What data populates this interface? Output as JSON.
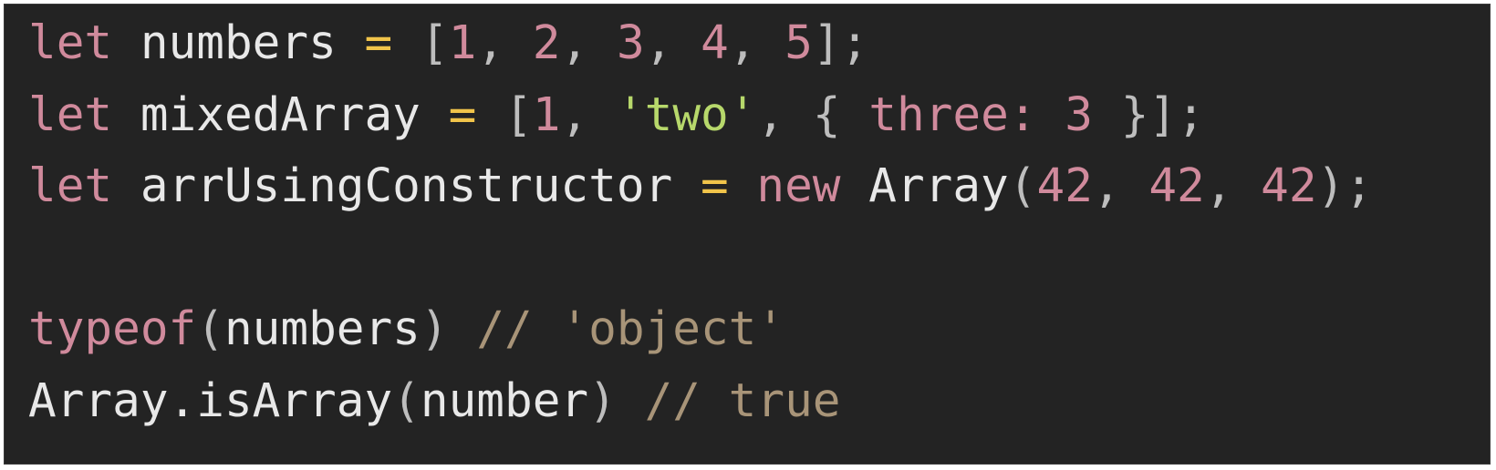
{
  "code": {
    "line1": {
      "kw": "let",
      "name": "numbers",
      "op": "=",
      "open": "[",
      "n1": "1",
      "n2": "2",
      "n3": "3",
      "n4": "4",
      "n5": "5",
      "close": "];"
    },
    "line2": {
      "kw": "let",
      "name": "mixedArray",
      "op": "=",
      "open": "[",
      "n1": "1",
      "str": "'two'",
      "brace_open": "{",
      "prop": "three:",
      "val": "3",
      "brace_close": "}",
      "close": "];"
    },
    "line3": {
      "kw": "let",
      "name": "arrUsingConstructor",
      "op": "=",
      "new_kw": "new",
      "ctor": "Array",
      "paren_open": "(",
      "a1": "42",
      "a2": "42",
      "a3": "42",
      "close": ");"
    },
    "line5": {
      "fn": "typeof",
      "paren_open": "(",
      "arg": "numbers",
      "paren_close": ")",
      "comment": "// 'object'"
    },
    "line6": {
      "obj": "Array",
      "method": ".isArray",
      "paren_open": "(",
      "arg": "number",
      "paren_close": ")",
      "comment": "// true"
    },
    "colors": {
      "background": "#232323",
      "keyword": "#d08a9c",
      "operator": "#f1c44a",
      "string": "#b7d86b",
      "comment": "#a89478",
      "identifier": "#e8e8e8"
    }
  }
}
